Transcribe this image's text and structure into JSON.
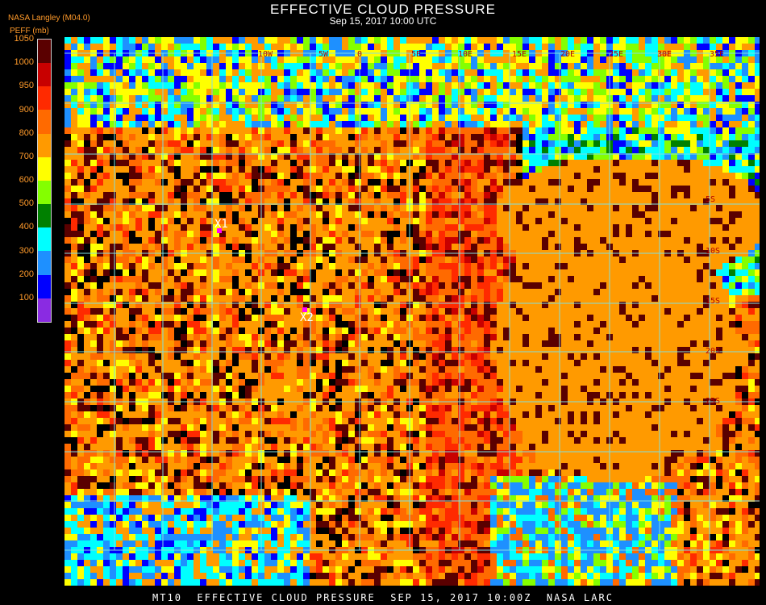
{
  "header": {
    "title": "EFFECTIVE CLOUD PRESSURE",
    "subtitle": "Sep 15, 2017 10:00 UTC",
    "source": "NASA Langley (M04.0)",
    "unit": "PEFF (mb)"
  },
  "legend": {
    "labels": [
      "1050",
      "1000",
      "950",
      "900",
      "800",
      "700",
      "600",
      "500",
      "400",
      "300",
      "200",
      "100"
    ],
    "colors": [
      "#5a0000",
      "#c80000",
      "#ff2a00",
      "#ff6a00",
      "#ff9a00",
      "#ffff00",
      "#84ff00",
      "#008000",
      "#00ffff",
      "#1e90ff",
      "#0000ff",
      "#8a2be2"
    ]
  },
  "map": {
    "markers": [
      {
        "label": "X1"
      },
      {
        "label": "X2"
      }
    ],
    "grid_labels": [
      "10W",
      "5W",
      "0",
      "5E",
      "10E",
      "15E",
      "20E",
      "25E",
      "30E",
      "35E",
      "5S",
      "10S",
      "15S",
      "20S",
      "25S"
    ]
  },
  "footer": {
    "text": "MT10  EFFECTIVE CLOUD PRESSURE  SEP 15, 2017 10:00Z  NASA LARC"
  }
}
